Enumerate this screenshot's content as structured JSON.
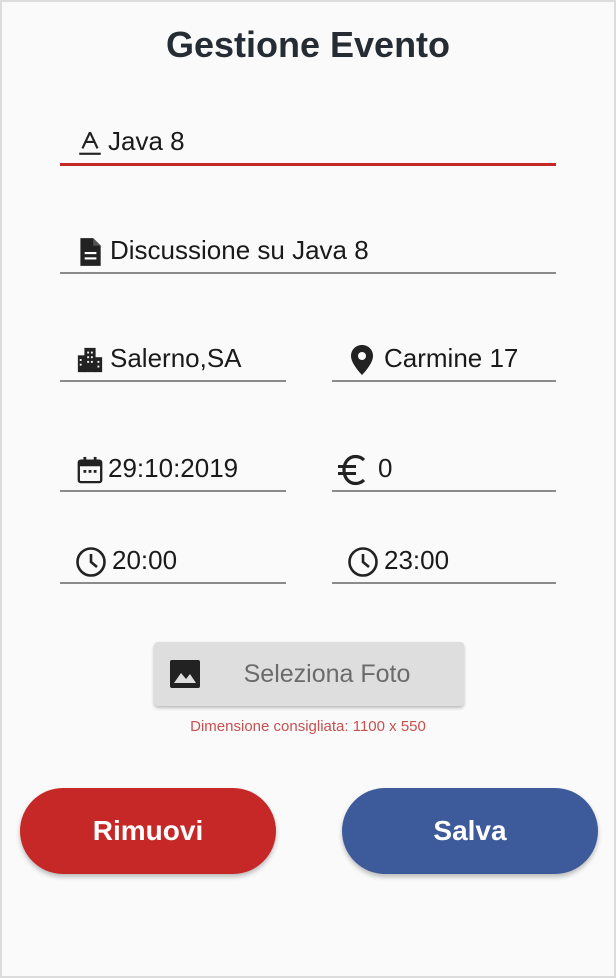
{
  "screen": {
    "title": "Gestione Evento"
  },
  "fields": {
    "name": {
      "value": "Java 8",
      "icon": "text-format-icon"
    },
    "description": {
      "value": "Discussione su Java 8",
      "icon": "document-icon"
    },
    "city": {
      "value": "Salerno,SA",
      "icon": "city-icon"
    },
    "address": {
      "value": "Carmine 17",
      "icon": "location-pin-icon"
    },
    "date": {
      "value": "29:10:2019",
      "icon": "calendar-icon"
    },
    "price": {
      "value": "0",
      "icon": "euro-icon"
    },
    "start_time": {
      "value": "20:00",
      "icon": "clock-icon"
    },
    "end_time": {
      "value": "23:00",
      "icon": "clock-icon"
    }
  },
  "photo": {
    "button_label": "Seleziona Foto",
    "icon": "image-icon",
    "hint": "Dimensione consigliata: 1100 x 550"
  },
  "actions": {
    "remove_label": "Rimuovi",
    "save_label": "Salva"
  },
  "colors": {
    "accent_red": "#c62828",
    "save_blue": "#3d5a9a",
    "hint_red": "#c85050"
  }
}
